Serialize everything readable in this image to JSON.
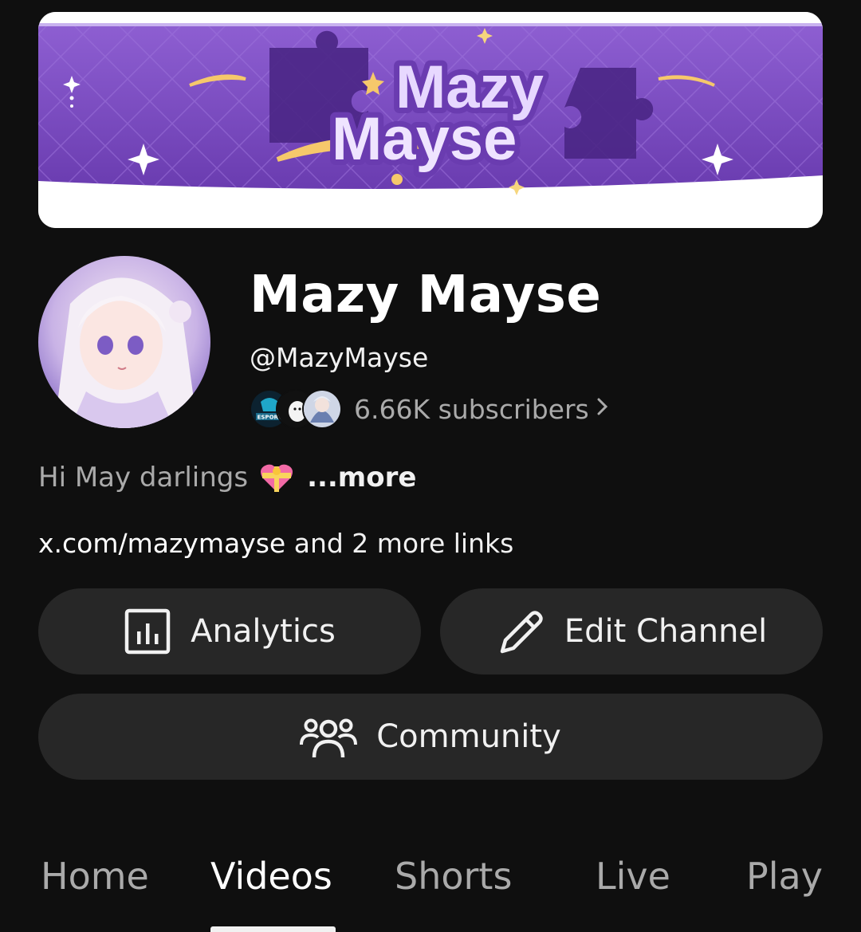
{
  "banner": {
    "logo_line1": "Mazy",
    "logo_line2": "Mayse",
    "colors": {
      "bg": "#7a4cc0",
      "light": "#e7d8ff",
      "accent": "#f6c86b"
    }
  },
  "avatar": {
    "icon": "anime-girl-avatar"
  },
  "channel": {
    "name": "Mazy Mayse",
    "handle": "@MazyMayse",
    "subscribers": "6.66K subscribers",
    "subscriber_avatars": [
      {
        "icon": "esport-avatar",
        "label": "ESPORT"
      },
      {
        "icon": "white-creature-avatar"
      },
      {
        "icon": "anime-avatar"
      }
    ],
    "chevron_icon": "chevron-right-icon"
  },
  "description": {
    "text": "Hi May darlings",
    "emoji_icon": "heart-with-ribbon-emoji",
    "more": "...more"
  },
  "links": {
    "url": "x.com/mazymayse",
    "extra": " and 2 more links"
  },
  "buttons": {
    "analytics": "Analytics",
    "edit_channel": "Edit Channel",
    "community": "Community"
  },
  "tabs": [
    {
      "label": "Home",
      "active": false
    },
    {
      "label": "Videos",
      "active": true
    },
    {
      "label": "Shorts",
      "active": false
    },
    {
      "label": "Live",
      "active": false
    },
    {
      "label": "Play",
      "active": false
    }
  ],
  "colors": {
    "background": "#0f0f0f",
    "button_bg": "#272727",
    "secondary_text": "#aaaaaa"
  }
}
